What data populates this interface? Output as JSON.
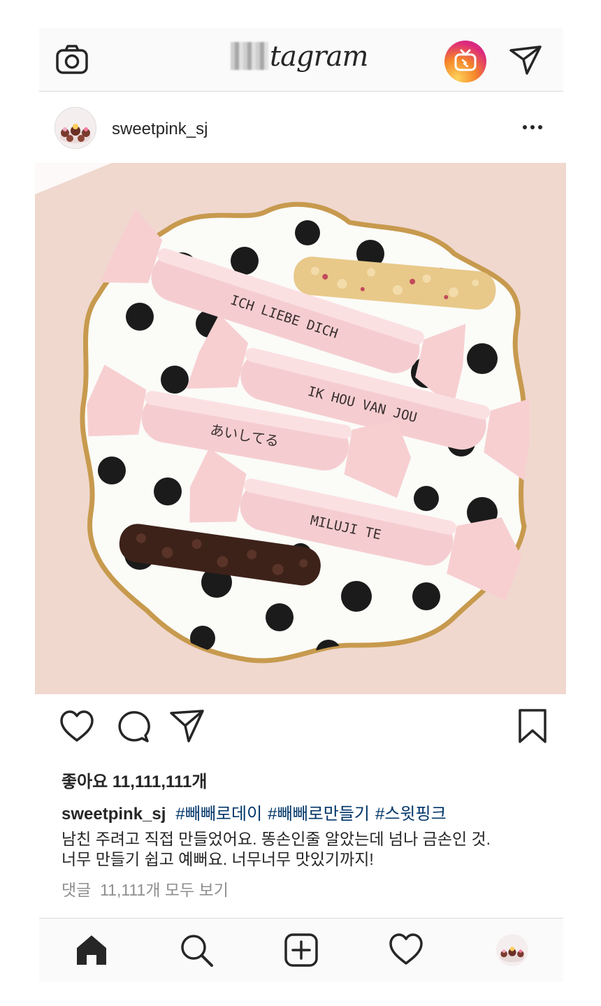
{
  "app": {
    "logo_text": "tagram"
  },
  "post": {
    "username": "sweetpink_sj",
    "photo_labels": [
      "ICH LIEBE DICH",
      "IK HOU VAN JOU",
      "あいしてる",
      "MILUJI TE"
    ],
    "likes": "좋아요 11,111,111개",
    "caption_username": "sweetpink_sj",
    "hashtags": [
      "#빼빼로데이",
      "#빼빼로만들기",
      "#스윗핑크"
    ],
    "caption_lines": [
      "남친 주려고 직접 만들었어요. 똥손인줄 알았는데 넘나 금손인 것.",
      "너무 만들기 쉽고 예뻐요. 너무너무 맛있기까지!"
    ],
    "comments_link": "댓글  11,111개 모두 보기"
  },
  "icons": {
    "top_left": "camera-icon",
    "top_right_1": "igtv-icon",
    "top_right_2": "direct-send-icon",
    "actions": [
      "heart-icon",
      "comment-icon",
      "share-icon",
      "bookmark-icon"
    ],
    "bottom_nav": [
      "home-icon",
      "search-icon",
      "add-post-icon",
      "activity-heart-icon",
      "profile-avatar"
    ]
  },
  "colors": {
    "hashtag": "#003569",
    "muted": "#8e8e8e",
    "text": "#262626",
    "bar_bg": "#fafafa",
    "divider": "#dbdbdb"
  }
}
